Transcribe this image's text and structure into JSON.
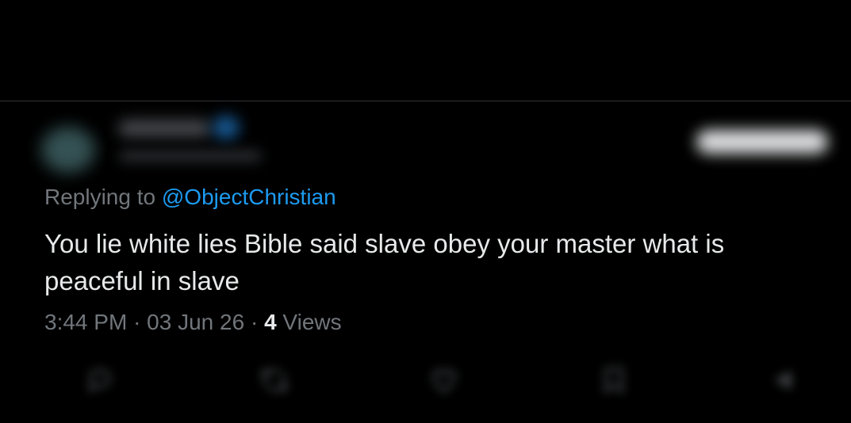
{
  "tweet": {
    "reply_prefix": "Replying to ",
    "reply_handle": "@ObjectChristian",
    "text": "You lie white lies Bible said slave obey your master what is peaceful in slave",
    "time": "3:44 PM",
    "date": "03 Jun 26",
    "views_count": "4",
    "views_label": "Views",
    "separator": "·"
  },
  "colors": {
    "background": "#000000",
    "text": "#e7e9ea",
    "muted": "#71767b",
    "link": "#1d9bf0"
  },
  "actions": [
    {
      "icon": "reply-icon"
    },
    {
      "icon": "retweet-icon"
    },
    {
      "icon": "like-icon"
    },
    {
      "icon": "bookmark-icon"
    },
    {
      "icon": "share-icon"
    }
  ]
}
